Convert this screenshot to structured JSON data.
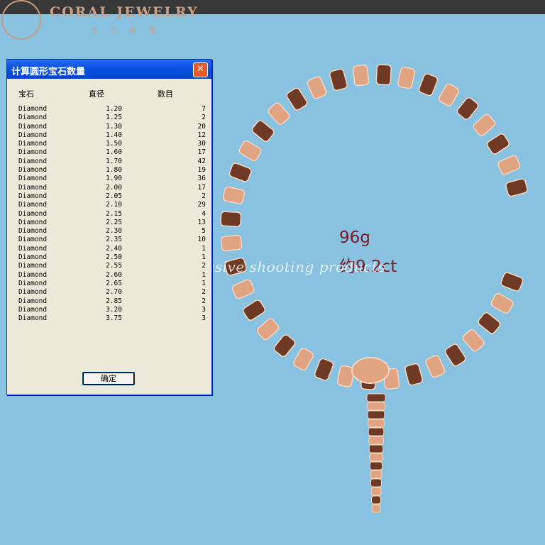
{
  "brand": {
    "name": "CORAL JEWELRY",
    "subtitle": "卡 兰 珠 宝"
  },
  "dialog": {
    "title": "计算圆形宝石数量",
    "close_glyph": "✕",
    "headers": {
      "gem": "宝石",
      "diameter": "直径",
      "count": "数目"
    },
    "rows": [
      {
        "gem": "Diamond",
        "diameter": "1.20",
        "count": "7"
      },
      {
        "gem": "Diamond",
        "diameter": "1.25",
        "count": "2"
      },
      {
        "gem": "Diamond",
        "diameter": "1.30",
        "count": "20"
      },
      {
        "gem": "Diamond",
        "diameter": "1.40",
        "count": "12"
      },
      {
        "gem": "Diamond",
        "diameter": "1.50",
        "count": "30"
      },
      {
        "gem": "Diamond",
        "diameter": "1.60",
        "count": "17"
      },
      {
        "gem": "Diamond",
        "diameter": "1.70",
        "count": "42"
      },
      {
        "gem": "Diamond",
        "diameter": "1.80",
        "count": "19"
      },
      {
        "gem": "Diamond",
        "diameter": "1.90",
        "count": "36"
      },
      {
        "gem": "Diamond",
        "diameter": "2.00",
        "count": "17"
      },
      {
        "gem": "Diamond",
        "diameter": "2.05",
        "count": "2"
      },
      {
        "gem": "Diamond",
        "diameter": "2.10",
        "count": "29"
      },
      {
        "gem": "Diamond",
        "diameter": "2.15",
        "count": "4"
      },
      {
        "gem": "Diamond",
        "diameter": "2.25",
        "count": "13"
      },
      {
        "gem": "Diamond",
        "diameter": "2.30",
        "count": "5"
      },
      {
        "gem": "Diamond",
        "diameter": "2.35",
        "count": "10"
      },
      {
        "gem": "Diamond",
        "diameter": "2.40",
        "count": "1"
      },
      {
        "gem": "Diamond",
        "diameter": "2.50",
        "count": "1"
      },
      {
        "gem": "Diamond",
        "diameter": "2.55",
        "count": "2"
      },
      {
        "gem": "Diamond",
        "diameter": "2.60",
        "count": "1"
      },
      {
        "gem": "Diamond",
        "diameter": "2.65",
        "count": "1"
      },
      {
        "gem": "Diamond",
        "diameter": "2.70",
        "count": "2"
      },
      {
        "gem": "Diamond",
        "diameter": "2.85",
        "count": "2"
      },
      {
        "gem": "Diamond",
        "diameter": "3.20",
        "count": "3"
      },
      {
        "gem": "Diamond",
        "diameter": "3.75",
        "count": "3"
      }
    ],
    "ok_label": "确定"
  },
  "info": {
    "weight": "96g",
    "carat": "约9.2ct"
  },
  "watermark": "Exclusive shooting products",
  "colors": {
    "background": "#88c2e0",
    "titlebar": "#0a54e3",
    "rose_gold": "#e0a482",
    "rose_gold_dark": "#6e3a26",
    "label_text": "#7a1b28"
  }
}
